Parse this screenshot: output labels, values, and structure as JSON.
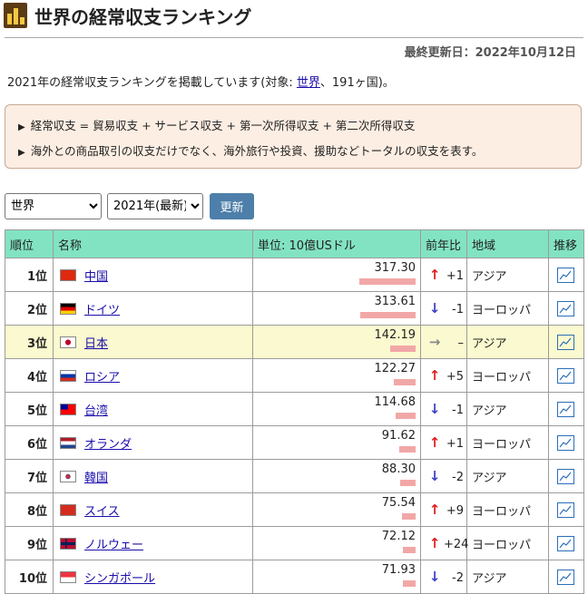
{
  "header": {
    "title": "世界の経常収支ランキング",
    "updated": "最終更新日：2022年10月12日"
  },
  "intro": {
    "pre": "2021年の経常収支ランキングを掲載しています(対象: ",
    "link": "世界",
    "post": "、191ヶ国)。"
  },
  "notice": {
    "lines": [
      "経常収支 = 貿易収支 + サービス収支 + 第一次所得収支 + 第二次所得収支",
      "海外との商品取引の収支だけでなく、海外旅行や投資、援助などトータルの収支を表す。"
    ]
  },
  "controls": {
    "region": "世界",
    "year": "2021年(最新)",
    "update": "更新"
  },
  "table": {
    "headers": [
      "順位",
      "名称",
      "単位: 10億USドル",
      "前年比",
      "地域",
      "推移"
    ],
    "rows": [
      {
        "rank": "1位",
        "name": "中国",
        "value": "317.30",
        "pct": 1.0,
        "dir": "up",
        "chg": "+1",
        "region": "アジア",
        "flag": "cn"
      },
      {
        "rank": "2位",
        "name": "ドイツ",
        "value": "313.61",
        "pct": 0.988,
        "dir": "down",
        "chg": "-1",
        "region": "ヨーロッパ",
        "flag": "de"
      },
      {
        "rank": "3位",
        "name": "日本",
        "value": "142.19",
        "pct": 0.448,
        "dir": "same",
        "chg": "–",
        "region": "アジア",
        "flag": "jp",
        "hl": true
      },
      {
        "rank": "4位",
        "name": "ロシア",
        "value": "122.27",
        "pct": 0.385,
        "dir": "up",
        "chg": "+5",
        "region": "ヨーロッパ",
        "flag": "ru"
      },
      {
        "rank": "5位",
        "name": "台湾",
        "value": "114.68",
        "pct": 0.361,
        "dir": "down",
        "chg": "-1",
        "region": "アジア",
        "flag": "tw"
      },
      {
        "rank": "6位",
        "name": "オランダ",
        "value": "91.62",
        "pct": 0.289,
        "dir": "up",
        "chg": "+1",
        "region": "ヨーロッパ",
        "flag": "nl"
      },
      {
        "rank": "7位",
        "name": "韓国",
        "value": "88.30",
        "pct": 0.278,
        "dir": "down",
        "chg": "-2",
        "region": "アジア",
        "flag": "kr"
      },
      {
        "rank": "8位",
        "name": "スイス",
        "value": "75.54",
        "pct": 0.238,
        "dir": "up",
        "chg": "+9",
        "region": "ヨーロッパ",
        "flag": "ch"
      },
      {
        "rank": "9位",
        "name": "ノルウェー",
        "value": "72.12",
        "pct": 0.227,
        "dir": "up",
        "chg": "+24",
        "region": "ヨーロッパ",
        "flag": "no"
      },
      {
        "rank": "10位",
        "name": "シンガポール",
        "value": "71.93",
        "pct": 0.227,
        "dir": "down",
        "chg": "-2",
        "region": "アジア",
        "flag": "sg"
      }
    ]
  },
  "colors": {
    "up": "#e02020",
    "down": "#4040c8",
    "same": "#888888",
    "header": "#82e3c2",
    "highlight": "#fbf9cf",
    "bar": "#f2a7a7"
  }
}
